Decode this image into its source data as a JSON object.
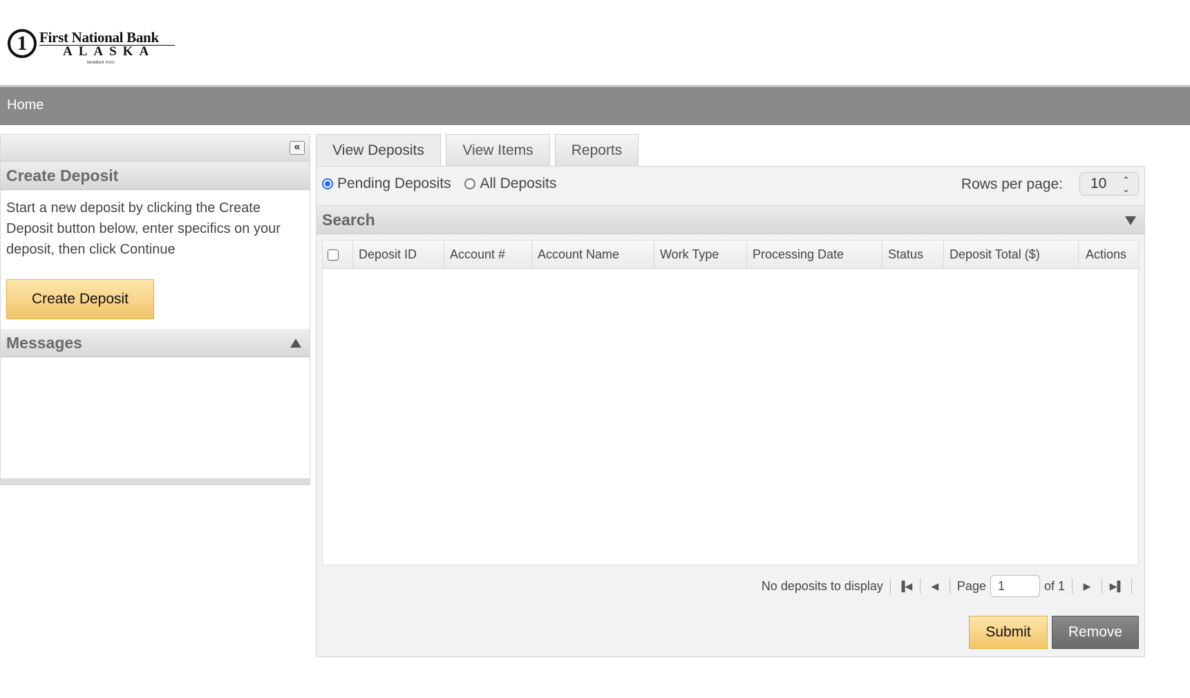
{
  "brand": {
    "logo_numeral": "1",
    "logo_name": "First National Bank",
    "logo_sub": "ALASKA",
    "logo_fdic": "MEMBER FDIC"
  },
  "nav": {
    "home": "Home"
  },
  "left": {
    "collapse_glyph": "«",
    "create_title": "Create Deposit",
    "create_desc": "Start a new deposit by clicking the Create Deposit button below, enter specifics on your deposit, then click Continue",
    "create_button": "Create Deposit",
    "messages_title": "Messages"
  },
  "tabs": [
    {
      "label": "View Deposits",
      "active": true
    },
    {
      "label": "View Items",
      "active": false
    },
    {
      "label": "Reports",
      "active": false
    }
  ],
  "filters": {
    "pending": "Pending Deposits",
    "all": "All Deposits",
    "selected": "pending"
  },
  "rows_per_page": {
    "label": "Rows per page:",
    "value": "10"
  },
  "search": {
    "label": "Search"
  },
  "table": {
    "columns": [
      "Deposit ID",
      "Account #",
      "Account Name",
      "Work Type",
      "Processing Date",
      "Status",
      "Deposit Total ($)",
      "Actions"
    ],
    "rows": []
  },
  "pager": {
    "empty_text": "No deposits to display",
    "page_label": "Page",
    "page_value": "1",
    "of_label": "of 1"
  },
  "actions": {
    "submit": "Submit",
    "remove": "Remove"
  },
  "colors": {
    "nav_bg": "#8a8a8a",
    "primary_btn": "#f2c467",
    "secondary_btn": "#6a6a6a",
    "radio_accent": "#2a6ae0"
  }
}
